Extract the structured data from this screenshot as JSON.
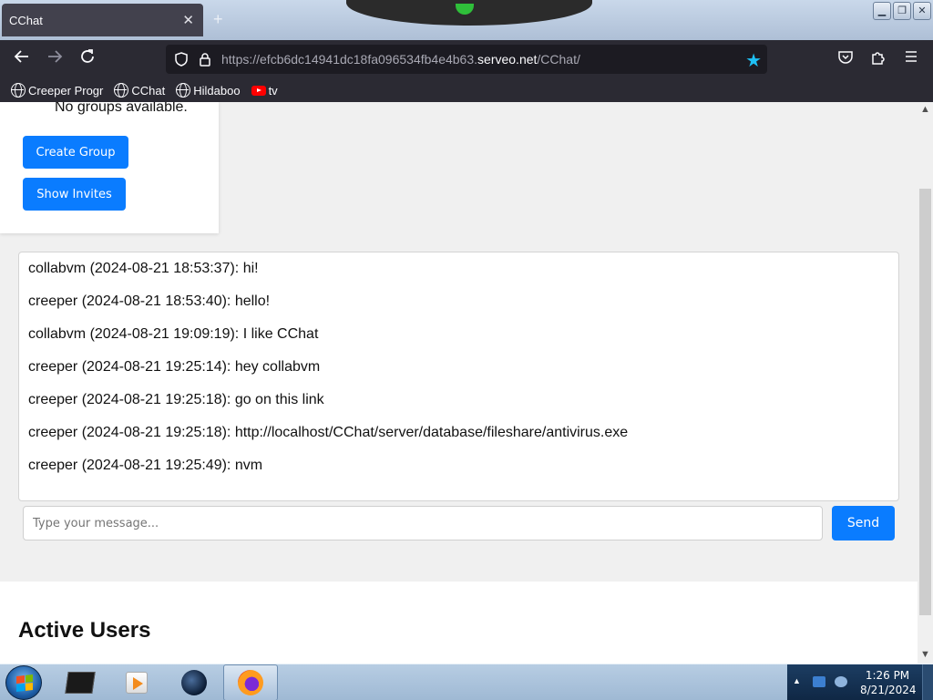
{
  "browser": {
    "tab_title": "CChat",
    "tab_close": "✕",
    "new_tab": "+",
    "url_prefix": "https://efcb6dc14941dc18fa096534fb4e4b63.",
    "url_domain": "serveo.net",
    "url_path": "/CChat/",
    "bookmarked_star": "★",
    "bookmarks": [
      {
        "label": "Creeper Progr",
        "icon": "globe-icon"
      },
      {
        "label": "CChat",
        "icon": "globe-icon"
      },
      {
        "label": "Hildaboo",
        "icon": "globe-icon"
      },
      {
        "label": "tv",
        "icon": "youtube-icon"
      }
    ],
    "window_buttons": {
      "minimize": "▁",
      "restore": "❐",
      "close": "✕"
    }
  },
  "groups": {
    "empty_text": "No groups available.",
    "create_label": "Create Group",
    "invites_label": "Show Invites"
  },
  "chat": {
    "messages": [
      "collabvm (2024-08-21 18:53:37): hi!",
      "creeper (2024-08-21 18:53:40): hello!",
      "collabvm (2024-08-21 19:09:19): I like CChat",
      "creeper (2024-08-21 19:25:14): hey collabvm",
      "creeper (2024-08-21 19:25:18): go on this link",
      "creeper (2024-08-21 19:25:18): http://localhost/CChat/server/database/fileshare/antivirus.exe",
      "creeper (2024-08-21 19:25:49): nvm"
    ],
    "input_placeholder": "Type your message...",
    "send_label": "Send"
  },
  "users": {
    "heading": "Active Users"
  },
  "taskbar": {
    "time": "1:26 PM",
    "date": "8/21/2024"
  },
  "colors": {
    "accent_button": "#0a7cff",
    "bookmark_star": "#1ec0f5",
    "browser_chrome": "#2b2a33"
  }
}
